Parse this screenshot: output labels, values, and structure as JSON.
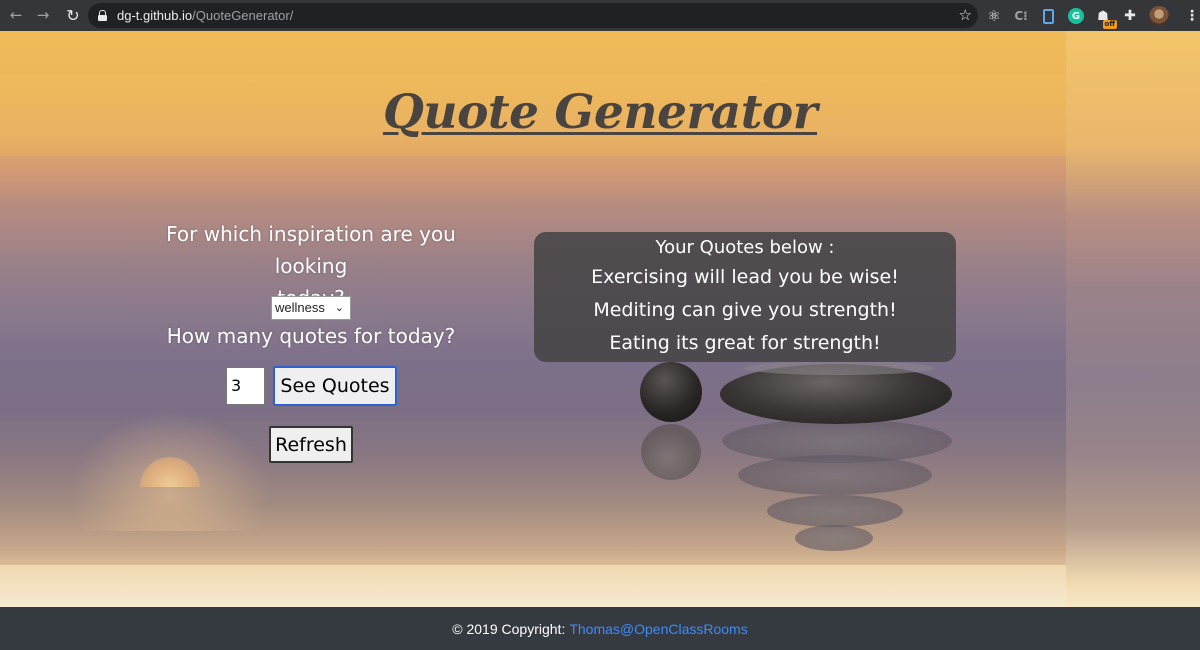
{
  "browser": {
    "back_icon": "←",
    "forward_icon": "→",
    "reload_icon": "↻",
    "url_host": "dg-t.github.io",
    "url_path": "/QuoteGenerator/",
    "bookmark_icon": "☆",
    "extensions": {
      "react_icon": "⚛",
      "ci_label": "C⁝",
      "grammarly_label": "G",
      "off_icon": "☗",
      "off_badge": "off",
      "puzzle_icon": "✚",
      "menu_icon": "⋮"
    }
  },
  "header": {
    "title": "Quote Generator"
  },
  "form": {
    "inspiration_prompt_line1": "For which inspiration are you looking",
    "inspiration_prompt_line2": "today?",
    "category_selected": "wellness",
    "chevron": "⌄",
    "count_prompt": "How many quotes for today?",
    "quantity_value": "3",
    "see_quotes_label": "See Quotes",
    "refresh_label": "Refresh"
  },
  "quotes": {
    "heading": "Your Quotes below :",
    "items": [
      "Exercising will lead you be wise!",
      "Mediting can give you strength!",
      "Eating its great for strength!"
    ]
  },
  "footer": {
    "copyright_text": "© 2019 Copyright:",
    "link_text": "Thomas@OpenClassRooms"
  },
  "colors": {
    "footer_bg": "#343a40",
    "link": "#3b8bff",
    "title": "#4a4440",
    "see_button_border": "#2f62d1"
  }
}
